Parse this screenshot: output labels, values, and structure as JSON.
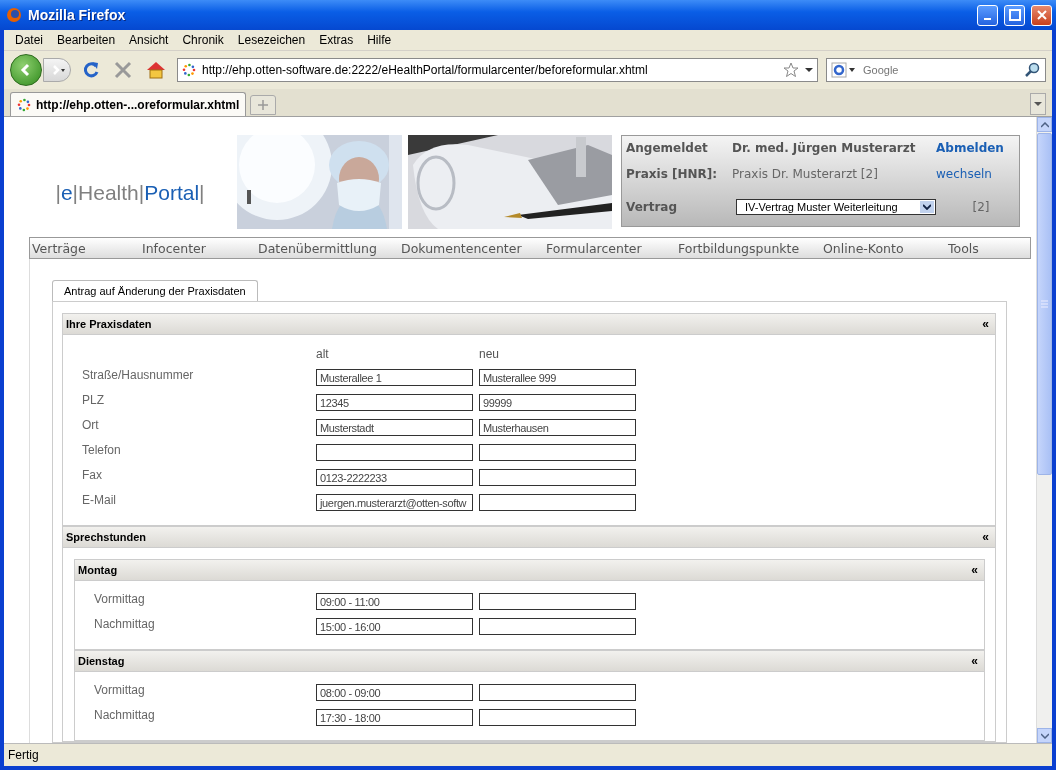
{
  "window": {
    "title": "Mozilla Firefox"
  },
  "menu": [
    "Datei",
    "Bearbeiten",
    "Ansicht",
    "Chronik",
    "Lesezeichen",
    "Extras",
    "Hilfe"
  ],
  "address_bar": {
    "value": "http://ehp.otten-software.de:2222/eHealthPortal/formularcenter/beforeformular.xhtml"
  },
  "search": {
    "placeholder": "Google"
  },
  "tabs": [
    {
      "label": "http://ehp.otten-...oreformular.xhtml",
      "selected": true
    }
  ],
  "logo": [
    {
      "text": "|",
      "color": "#808080"
    },
    {
      "text": "e",
      "color": "#1a5fb4"
    },
    {
      "text": "|",
      "color": "#808080"
    },
    {
      "text": "Health",
      "color": "#808080"
    },
    {
      "text": "|",
      "color": "#808080"
    },
    {
      "text": "Portal",
      "color": "#1a5fb4"
    },
    {
      "text": "|",
      "color": "#808080"
    }
  ],
  "login": {
    "label_user": "Angemeldet",
    "user": "Dr. med. Jürgen Musterarzt",
    "logout": "Abmelden",
    "label_practice": "Praxis [HNR]:",
    "practice": "Praxis Dr. Musterarzt [2]",
    "switch": "wechseln",
    "label_contract": "Vertrag",
    "contract": "IV-Vertrag Muster Weiterleitung",
    "contract_count": "[2]"
  },
  "nav": [
    "Verträge",
    "Infocenter",
    "Datenübermittlung",
    "Dokumentencenter",
    "Formularcenter",
    "Fortbildungspunkte",
    "Online-Konto",
    "Tools"
  ],
  "form_tabs": [
    {
      "label": "Antrag auf Änderung der Praxisdaten",
      "selected": true
    }
  ],
  "praxisdaten": {
    "title": "Ihre Praxisdaten",
    "collapse": "«",
    "columns": [
      "alt",
      "neu"
    ],
    "rows": [
      {
        "label": "Straße/Hausnummer",
        "alt": "Musterallee 1",
        "neu": "Musterallee 999"
      },
      {
        "label": "PLZ",
        "alt": "12345",
        "neu": "99999"
      },
      {
        "label": "Ort",
        "alt": "Musterstadt",
        "neu": "Musterhausen"
      },
      {
        "label": "Telefon"
      },
      {
        "label": "Fax",
        "alt": "0123-2222233"
      },
      {
        "label": "E-Mail",
        "alt": "juergen.musterarzt@otten-softw"
      }
    ]
  },
  "sprechstunden": {
    "title": "Sprechstunden",
    "collapse": "«",
    "days": [
      {
        "title": "Montag",
        "collapse": "«",
        "rows": [
          {
            "label": "Vormittag",
            "alt": "09:00 - 11:00"
          },
          {
            "label": "Nachmittag",
            "alt": "15:00 - 16:00"
          }
        ]
      },
      {
        "title": "Dienstag",
        "collapse": "«",
        "rows": [
          {
            "label": "Vormittag",
            "alt": "08:00 - 09:00"
          },
          {
            "label": "Nachmittag",
            "alt": "17:30 - 18:00"
          }
        ]
      }
    ]
  },
  "status_bar": {
    "text": "Fertig"
  }
}
